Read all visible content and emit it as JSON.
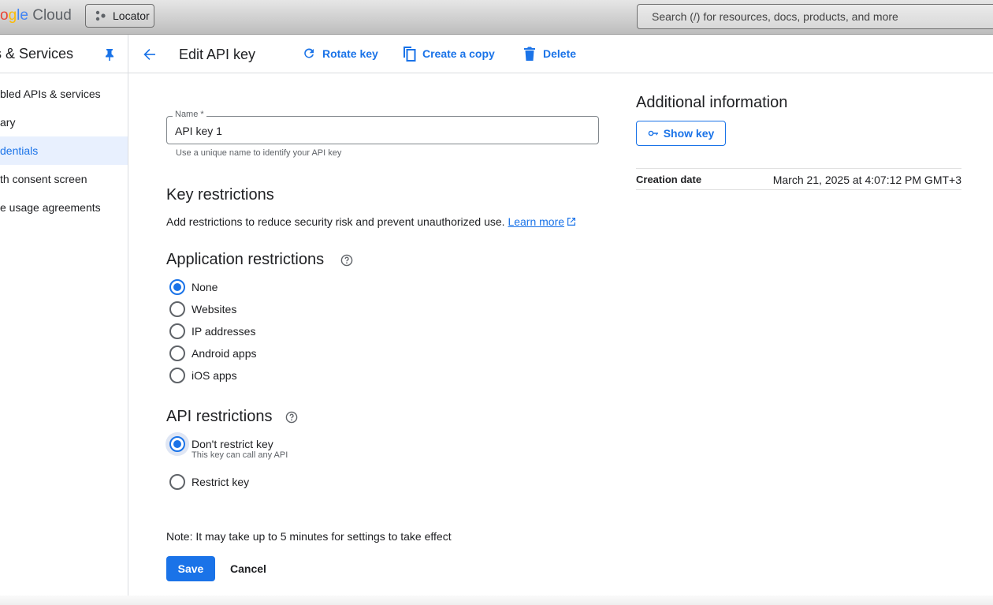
{
  "topbar": {
    "logo_parts": [
      "o",
      "g",
      "le",
      " Cloud"
    ],
    "project_label": "Locator",
    "search_placeholder": "Search (/) for resources, docs, products, and more"
  },
  "sidebar": {
    "title": "s & Services",
    "items": [
      {
        "label": "bled APIs & services",
        "active": false
      },
      {
        "label": "ary",
        "active": false
      },
      {
        "label": "dentials",
        "active": true
      },
      {
        "label": "th consent screen",
        "active": false
      },
      {
        "label": "e usage agreements",
        "active": false
      }
    ]
  },
  "actionbar": {
    "title": "Edit API key",
    "rotate_label": "Rotate key",
    "copy_label": "Create a copy",
    "delete_label": "Delete"
  },
  "form": {
    "name_label": "Name *",
    "name_value": "API key 1",
    "name_hint": "Use a unique name to identify your API key",
    "key_restrictions_title": "Key restrictions",
    "key_restrictions_desc": "Add restrictions to reduce security risk and prevent unauthorized use.",
    "learn_more": "Learn more",
    "app_restrictions_title": "Application restrictions",
    "app_options": [
      {
        "label": "None",
        "checked": true
      },
      {
        "label": "Websites",
        "checked": false
      },
      {
        "label": "IP addresses",
        "checked": false
      },
      {
        "label": "Android apps",
        "checked": false
      },
      {
        "label": "iOS apps",
        "checked": false
      }
    ],
    "api_restrictions_title": "API restrictions",
    "api_options": [
      {
        "label": "Don't restrict key",
        "sub": "This key can call any API",
        "checked": true
      },
      {
        "label": "Restrict key",
        "sub": "",
        "checked": false
      }
    ],
    "note": "Note: It may take up to 5 minutes for settings to take effect",
    "save_label": "Save",
    "cancel_label": "Cancel"
  },
  "info": {
    "title": "Additional information",
    "show_key_label": "Show key",
    "creation_date_label": "Creation date",
    "creation_date_value": "March 21, 2025 at 4:07:12 PM GMT+3"
  },
  "colors": {
    "accent": "#1a73e8",
    "active_bg": "#e8f0fe"
  }
}
